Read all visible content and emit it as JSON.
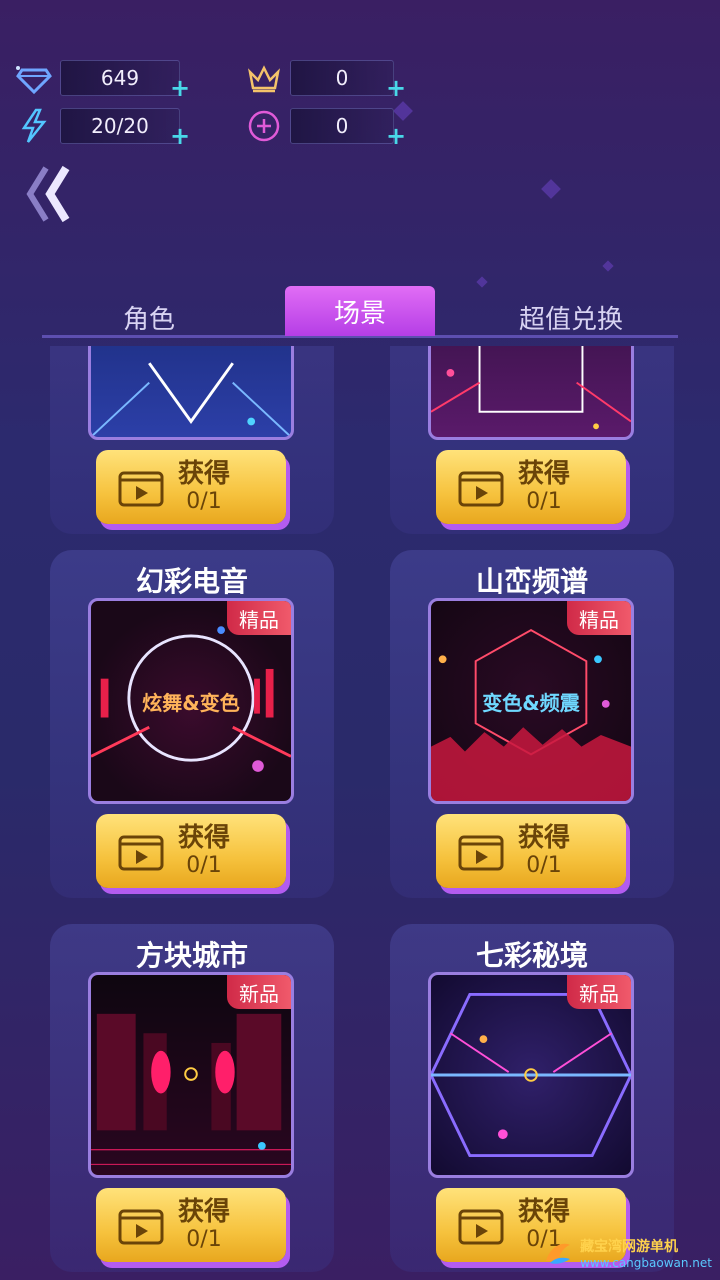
{
  "stats": {
    "gems": "649",
    "energy": "20/20",
    "crown": "0",
    "plus_coin": "0"
  },
  "icons": {
    "gem": "diamond-icon",
    "energy": "lightning-icon",
    "crown": "crown-icon",
    "plus_coin": "plus-circle-icon",
    "back": "double-chevron-left-icon",
    "video": "video-play-icon"
  },
  "tabs": [
    {
      "label": "角色",
      "active": false
    },
    {
      "label": "场景",
      "active": true
    },
    {
      "label": "超值兑换",
      "active": false
    }
  ],
  "cards": [
    {
      "title": "",
      "badge": "",
      "caption": "",
      "button_label": "获得",
      "progress": "0/1"
    },
    {
      "title": "",
      "badge": "",
      "caption": "",
      "button_label": "获得",
      "progress": "0/1"
    },
    {
      "title": "幻彩电音",
      "badge": "精品",
      "caption": "炫舞&变色",
      "button_label": "获得",
      "progress": "0/1"
    },
    {
      "title": "山峦频谱",
      "badge": "精品",
      "caption": "变色&频震",
      "button_label": "获得",
      "progress": "0/1"
    },
    {
      "title": "方块城市",
      "badge": "新品",
      "caption": "",
      "button_label": "获得",
      "progress": "0/1"
    },
    {
      "title": "七彩秘境",
      "badge": "新品",
      "caption": "",
      "button_label": "获得",
      "progress": "0/1"
    }
  ],
  "watermark": {
    "cn": "藏宝湾网游单机",
    "en": "www.cangbaowan.net"
  },
  "colors": {
    "accent_tab": "#c34ae9",
    "button_gold": "#f6c23d",
    "plus": "#49d8e8",
    "badge_red": "#e03a55"
  }
}
